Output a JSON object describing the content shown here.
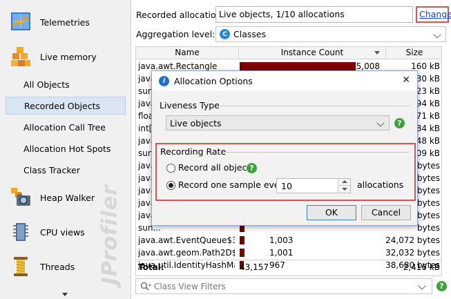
{
  "sidebar": {
    "categories": [
      {
        "label": "Telemetries",
        "icon": "telemetries-icon"
      },
      {
        "label": "Live memory",
        "icon": "live-memory-icon"
      },
      {
        "label": "Heap Walker",
        "icon": "heap-walker-icon"
      },
      {
        "label": "CPU views",
        "icon": "cpu-views-icon"
      },
      {
        "label": "Threads",
        "icon": "threads-icon"
      }
    ],
    "live_memory_items": [
      {
        "label": "All Objects"
      },
      {
        "label": "Recorded Objects",
        "selected": true
      },
      {
        "label": "Allocation Call Tree"
      },
      {
        "label": "Allocation Hot Spots"
      },
      {
        "label": "Class Tracker"
      }
    ],
    "watermark": "JProfiler"
  },
  "header": {
    "recorded_allocations_label": "Recorded allocations:",
    "recorded_allocations_value": "Live objects, 1/10 allocations",
    "change_link": "Change",
    "aggregation_label": "Aggregation level:",
    "aggregation_value": "Classes"
  },
  "table": {
    "columns": [
      "Name",
      "Instance Count",
      "Size"
    ],
    "rows": [
      {
        "name": "java.awt.Rectangle",
        "count": "5,008",
        "size": "160 kB",
        "bar": 1.0
      },
      {
        "name": "java...",
        "count": "",
        "size": "130 kB",
        "bar": 0.9
      },
      {
        "name": "sun...",
        "count": "",
        "size": "123 kB",
        "bar": 0.8
      },
      {
        "name": "java...",
        "count": "",
        "size": "94 kB",
        "bar": 0.7
      },
      {
        "name": "float...",
        "count": "",
        "size": "71 kB",
        "bar": 0.6
      },
      {
        "name": "int[]",
        "count": "",
        "size": "84 kB",
        "bar": 0.6
      },
      {
        "name": "java...",
        "count": "",
        "size": "48 kB",
        "bar": 0.5
      },
      {
        "name": "sun...",
        "count": "",
        "size": "809 kB",
        "bar": 0.5
      },
      {
        "name": "java...",
        "count": "",
        "size": "bytes",
        "bar": 0.4
      },
      {
        "name": "java...",
        "count": "",
        "size": "bytes",
        "bar": 0.4
      },
      {
        "name": "java...",
        "count": "",
        "size": "bytes",
        "bar": 0.3
      },
      {
        "name": "java...",
        "count": "",
        "size": "bytes",
        "bar": 0.3
      },
      {
        "name": "java...",
        "count": "",
        "size": "bytes",
        "bar": 0.3
      },
      {
        "name": "sun...",
        "count": "",
        "size": "bytes",
        "bar": 0.2
      },
      {
        "name": "java.awt.EventQueue$3",
        "count": "1,003",
        "size": "24,072 bytes",
        "bar": 0.2
      },
      {
        "name": "java.awt.geom.Path2D$Fl...",
        "count": "1,001",
        "size": "32,032 bytes",
        "bar": 0.2
      },
      {
        "name": "java.util.IdentityHashMap...",
        "count": "967",
        "size": "38,680 bytes",
        "bar": 0.19
      }
    ],
    "total_label": "Total:",
    "total_count": "43,157",
    "total_size": "2,416 kB"
  },
  "filter": {
    "placeholder": "Class View Filters"
  },
  "dialog": {
    "title": "Allocation Options",
    "liveness_title": "Liveness Type",
    "liveness_value": "Live objects",
    "rate_title": "Recording Rate",
    "record_all_label": "Record all objects",
    "record_sample_label": "Record one sample every",
    "sample_value": "10",
    "allocations_label": "allocations",
    "ok_label": "OK",
    "cancel_label": "Cancel"
  },
  "colors": {
    "bar": "#7b0000",
    "highlight": "#d9534f",
    "link": "#1a44c8",
    "help": "#3aa33a"
  }
}
